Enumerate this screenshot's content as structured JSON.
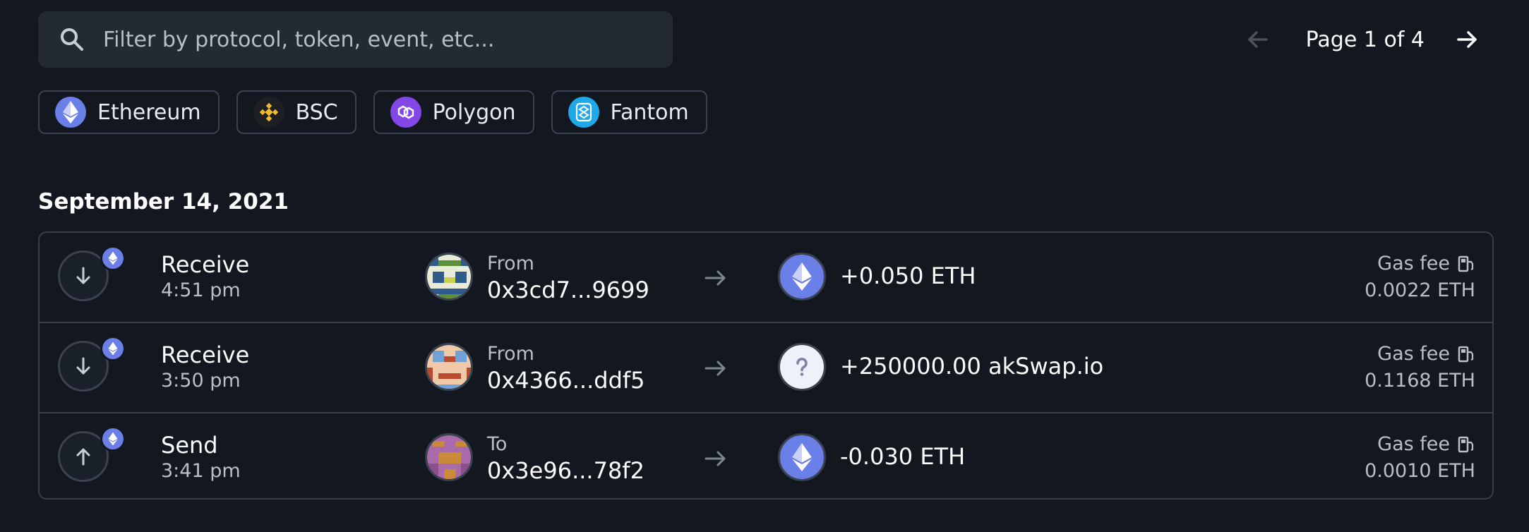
{
  "search": {
    "placeholder": "Filter by protocol, token, event, etc...",
    "icon": "search-icon"
  },
  "pager": {
    "label": "Page 1 of 4",
    "current_page": 1,
    "total_pages": 4
  },
  "chains": [
    {
      "label": "Ethereum",
      "icon": "ethereum-icon",
      "color": "#6b7fe8"
    },
    {
      "label": "BSC",
      "icon": "bsc-icon",
      "color": "#f3ba2f"
    },
    {
      "label": "Polygon",
      "icon": "polygon-icon",
      "color": "#8247e5"
    },
    {
      "label": "Fantom",
      "icon": "fantom-icon",
      "color": "#1fa8e8"
    }
  ],
  "date_header": "September 14, 2021",
  "transactions": [
    {
      "type": "Receive",
      "direction": "in",
      "time": "4:51 pm",
      "counterparty_label": "From",
      "counterparty": "0x3cd7...9699",
      "token_icon": "ethereum-icon",
      "amount": "+0.050 ETH",
      "gas_label": "Gas fee",
      "gas_fee": "0.0022 ETH"
    },
    {
      "type": "Receive",
      "direction": "in",
      "time": "3:50 pm",
      "counterparty_label": "From",
      "counterparty": "0x4366...ddf5",
      "token_icon": "unknown-token-icon",
      "amount": "+250000.00 akSwap.io",
      "gas_label": "Gas fee",
      "gas_fee": "0.1168 ETH"
    },
    {
      "type": "Send",
      "direction": "out",
      "time": "3:41 pm",
      "counterparty_label": "To",
      "counterparty": "0x3e96...78f2",
      "token_icon": "ethereum-icon",
      "amount": "-0.030 ETH",
      "gas_label": "Gas fee",
      "gas_fee": "0.0010 ETH"
    }
  ],
  "colors": {
    "background": "#131820",
    "surface": "#232a34",
    "border": "#363e4b",
    "ethereum": "#6b7fe8",
    "muted_text": "#b8bfca"
  }
}
